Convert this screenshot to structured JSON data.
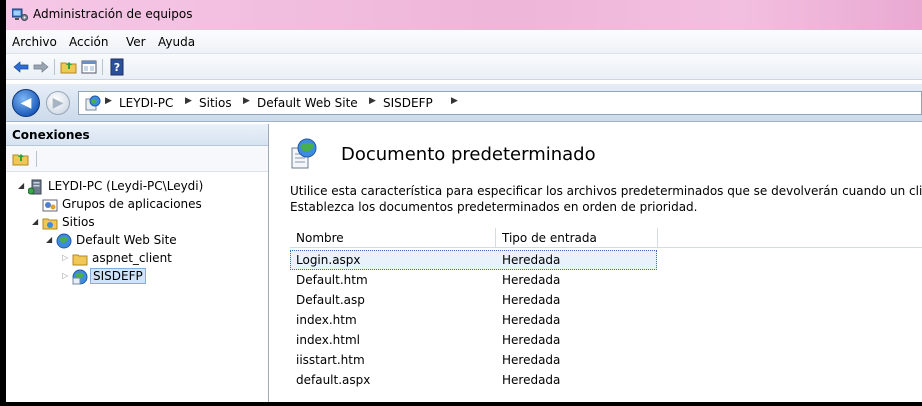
{
  "window": {
    "title": "Administración de equipos"
  },
  "menu": [
    "Archivo",
    "Acción",
    "Ver",
    "Ayuda"
  ],
  "toolbar_icons": [
    "back-arrow-icon",
    "forward-arrow-icon",
    "folder-up-icon",
    "properties-icon",
    "help-icon"
  ],
  "address": {
    "crumbs": [
      "LEYDI-PC",
      "Sitios",
      "Default Web Site",
      "SISDEFP"
    ]
  },
  "connections": {
    "header": "Conexiones",
    "tree": [
      {
        "label": "LEYDI-PC (Leydi-PC\\Leydi)",
        "icon": "server-icon"
      },
      {
        "label": "Grupos de aplicaciones",
        "icon": "app-pool-icon"
      },
      {
        "label": "Sitios",
        "icon": "sites-folder-icon"
      },
      {
        "label": "Default Web Site",
        "icon": "globe-icon"
      },
      {
        "label": "aspnet_client",
        "icon": "folder-icon"
      },
      {
        "label": "SISDEFP",
        "icon": "web-app-icon"
      }
    ]
  },
  "main": {
    "title": "Documento predeterminado",
    "description_line1": "Utilice esta característica para especificar los archivos predeterminados que se devolverán cuando un cliente no sol",
    "description_line2": "Establezca los documentos predeterminados en orden de prioridad.",
    "columns": [
      "Nombre",
      "Tipo de entrada"
    ],
    "rows": [
      {
        "name": "Login.aspx",
        "type": "Heredada"
      },
      {
        "name": "Default.htm",
        "type": "Heredada"
      },
      {
        "name": "Default.asp",
        "type": "Heredada"
      },
      {
        "name": "index.htm",
        "type": "Heredada"
      },
      {
        "name": "index.html",
        "type": "Heredada"
      },
      {
        "name": "iisstart.htm",
        "type": "Heredada"
      },
      {
        "name": "default.aspx",
        "type": "Heredada"
      }
    ],
    "selected_row": 0
  },
  "colors": {
    "titlebar": "#eeb6d9",
    "selection": "#cfe4fa",
    "accent": "#1f5fbf"
  }
}
